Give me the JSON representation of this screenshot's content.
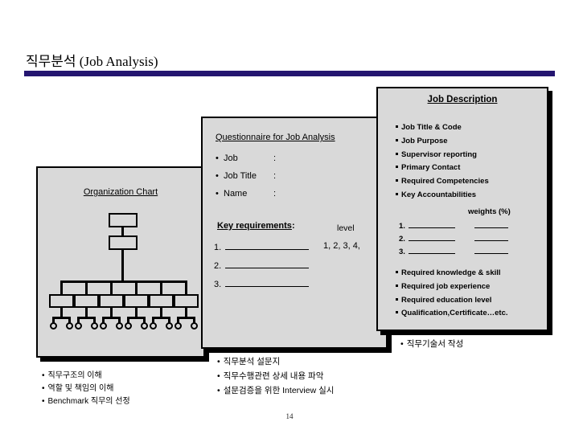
{
  "slide": {
    "title": "직무분석 (Job Analysis)",
    "page_number": "14",
    "rule_color": "#241570",
    "card_fill": "#d9d9d9"
  },
  "org_chart": {
    "title": "Organization Chart",
    "top_boxes": 2,
    "branch_boxes": 6,
    "leaf_circles_per_box": 2
  },
  "questionnaire": {
    "title": "Questionnaire for Job Analysis",
    "fields": [
      {
        "label": "Job",
        "colon": ":",
        "value": ""
      },
      {
        "label": "Job Title",
        "colon": ":",
        "value": ""
      },
      {
        "label": "Name",
        "colon": ":",
        "value": ""
      }
    ],
    "key_requirements": {
      "heading": "Key requirements",
      "heading_colon": ":",
      "level_label": "level",
      "level_scale": "1, 2, 3, 4,",
      "rows": [
        "1.",
        "2.",
        "3."
      ]
    }
  },
  "job_description": {
    "title": "Job Description",
    "items_top": [
      "Job Title & Code",
      "Job Purpose",
      "Supervisor reporting",
      "Primary Contact",
      "Required Competencies",
      "Key Accountabilities"
    ],
    "weights_label": "weights (%)",
    "numbered_rows": [
      "1.",
      "2.",
      "3."
    ],
    "items_bottom": [
      "Required knowledge & skill",
      "Required job experience",
      "Required education  level",
      "Qualification,Certificate…etc."
    ]
  },
  "bottom_notes": {
    "left": [
      "직무구조의 이해",
      "역할 및 책임의 이해",
      "Benchmark 직무의 선정"
    ],
    "middle": [
      "직무분석 설문지",
      "직무수행관련 상세 내용 파악",
      "설문검증을 위한 Interview 실시"
    ],
    "right": [
      "직무기술서 작성"
    ]
  }
}
